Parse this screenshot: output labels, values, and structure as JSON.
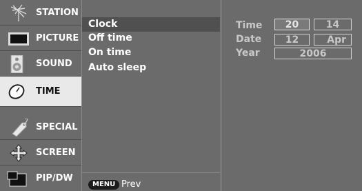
{
  "sidebar": {
    "items": [
      {
        "label": "STATION",
        "icon": "antenna-icon",
        "active": false
      },
      {
        "label": "PICTURE",
        "icon": "picture-icon",
        "active": false
      },
      {
        "label": "SOUND",
        "icon": "speaker-icon",
        "active": false
      },
      {
        "label": "TIME",
        "icon": "clock-icon",
        "active": true
      },
      {
        "label": "SPECIAL",
        "icon": "tag-icon",
        "active": false
      },
      {
        "label": "SCREEN",
        "icon": "move-arrows-icon",
        "active": false
      },
      {
        "label": "PIP/DW",
        "icon": "pip-icon",
        "active": false
      }
    ]
  },
  "submenu": {
    "items": [
      {
        "label": "Clock",
        "active": true
      },
      {
        "label": "Off time",
        "active": false
      },
      {
        "label": "On time",
        "active": false
      },
      {
        "label": "Auto sleep",
        "active": false
      }
    ],
    "footer": {
      "key_label": "MENU",
      "action_label": "Prev"
    }
  },
  "detail": {
    "time": {
      "label": "Time",
      "hour": "20",
      "minute": "14"
    },
    "date": {
      "label": "Date",
      "day": "12",
      "month": "Apr"
    },
    "year": {
      "label": "Year",
      "value": "2006"
    }
  },
  "colors": {
    "background": "#6b6b6b",
    "active_item": "#e9e9e9",
    "highlight_row": "#505050"
  }
}
